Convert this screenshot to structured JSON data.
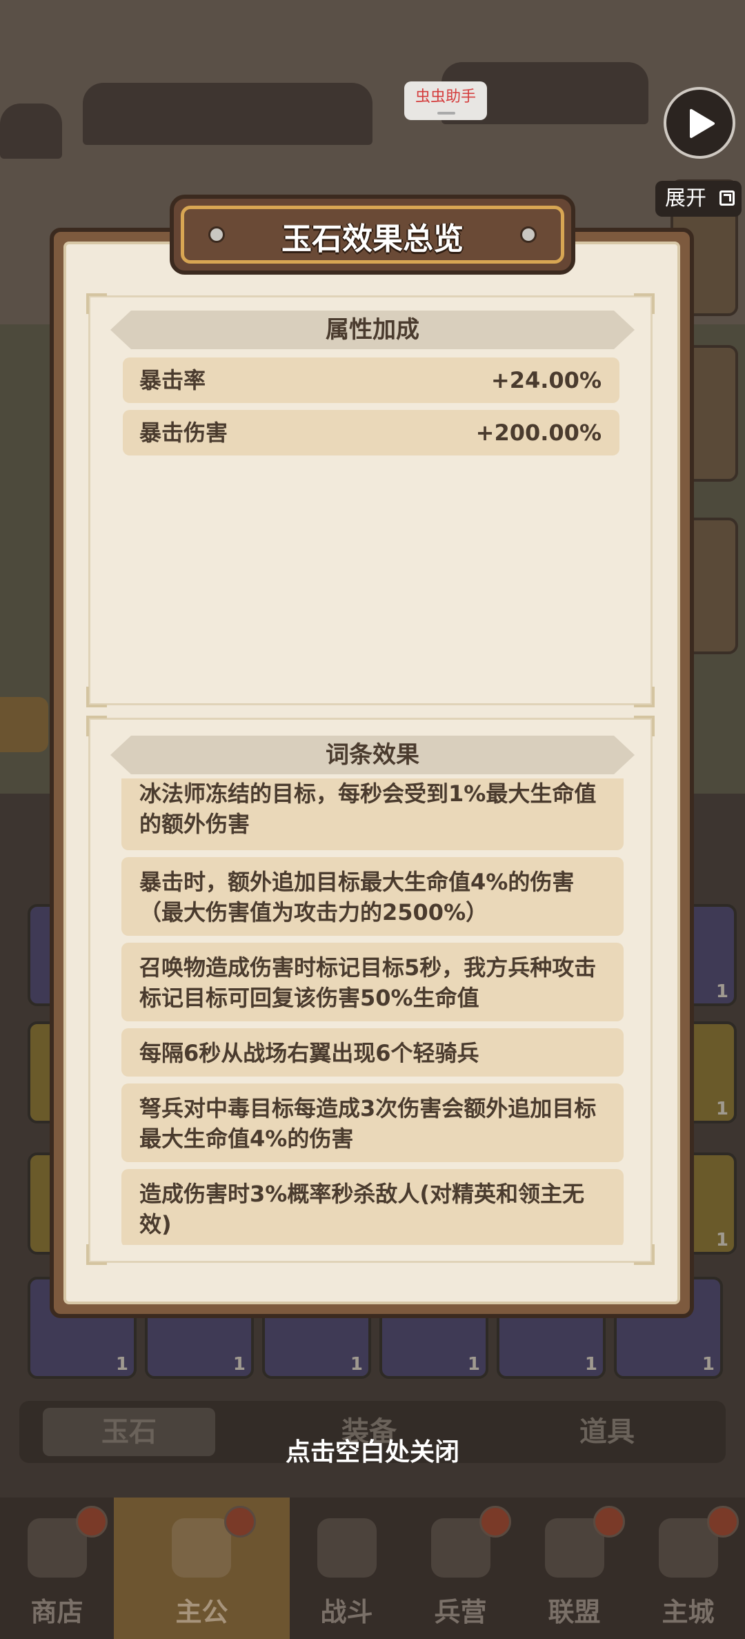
{
  "overlay": {
    "helper_label": "虫虫助手",
    "expand_label": "展开"
  },
  "dialog": {
    "title": "玉石效果总览",
    "attributes_header": "属性加成",
    "attributes": [
      {
        "label": "暴击率",
        "value": "+24.00%"
      },
      {
        "label": "暴击伤害",
        "value": "+200.00%"
      }
    ],
    "effects_header": "词条效果",
    "effects": [
      "冰法师冻结的目标，每秒会受到1%最大生命值的额外伤害",
      "暴击时，额外追加目标最大生命值4%的伤害（最大伤害值为攻击力的2500%）",
      "召唤物造成伤害时标记目标5秒，我方兵种攻击标记目标可回复该伤害50%生命值",
      "每隔6秒从战场右翼出现6个轻骑兵",
      "弩兵对中毒目标每造成3次伤害会额外追加目标最大生命值4%的伤害",
      "造成伤害时3%概率秒杀敌人(对精英和领主无效)"
    ],
    "close_hint": "点击空白处关闭"
  },
  "background": {
    "tabs": [
      {
        "label": "玉石",
        "active": true
      },
      {
        "label": "装备",
        "active": false
      },
      {
        "label": "道具",
        "active": false
      }
    ],
    "slot_count": "1",
    "bottom_nav": [
      {
        "label": "商店",
        "icon": "ship-icon",
        "active": false
      },
      {
        "label": "主公",
        "icon": "treasure-chest-icon",
        "active": true
      },
      {
        "label": "战斗",
        "icon": "crossed-swords-icon",
        "active": false
      },
      {
        "label": "兵营",
        "icon": "flag-swords-icon",
        "active": false
      },
      {
        "label": "联盟",
        "icon": "alliance-banner-icon",
        "active": false
      },
      {
        "label": "主城",
        "icon": "map-scroll-icon",
        "active": false
      }
    ]
  }
}
